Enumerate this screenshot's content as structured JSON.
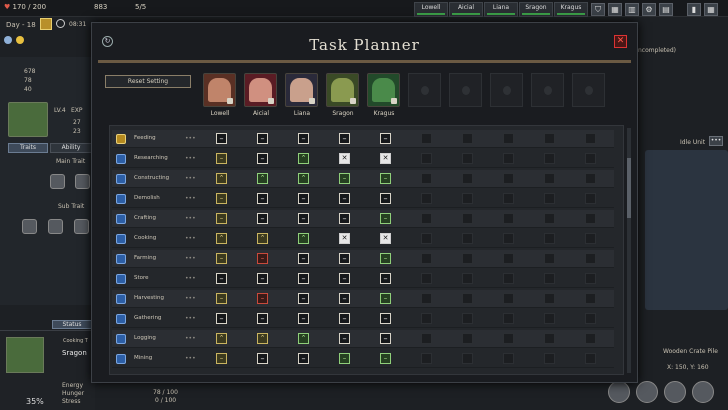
{
  "hud": {
    "day": "Day - 18",
    "time": "08:31",
    "food": "170 / 200",
    "coins": "883",
    "pop": "5/5",
    "stat1": "678",
    "stat2": "78",
    "stat3": "40",
    "colonist_tabs": [
      {
        "label": "Lowell"
      },
      {
        "label": "Aicial"
      },
      {
        "label": "Liana"
      },
      {
        "label": "Sragon"
      },
      {
        "label": "Kragus"
      }
    ]
  },
  "left_panel": {
    "level": "LV.4",
    "exp_label": "EXP",
    "v1": "27",
    "v2": "23",
    "tab_traits": "Traits",
    "tab_ability": "Ability",
    "main_trait": "Main Trait",
    "sub_trait": "Sub Trait"
  },
  "status_panel": {
    "tab_status": "Status",
    "name": "Sragon",
    "label_top": "Cooking T",
    "percent": "35%",
    "stat_energy": "Energy",
    "stat_hunger": "Hunger",
    "stat_stress": "Stress",
    "val_a": "78 / 100",
    "val_b": "0 / 100"
  },
  "right_side": {
    "completed": "ncompleted)",
    "idle_unit": "Idle Unit",
    "crate": "Wooden Crate Pile",
    "coords": "X: 150, Y: 160"
  },
  "modal": {
    "title": "Task Planner",
    "reset_label": "Reset Setting",
    "colonists": [
      "Lowell",
      "Aicial",
      "Liana",
      "Sragon",
      "Kragus"
    ],
    "tasks": [
      {
        "name": "Feeding",
        "icon": "yellow",
        "cells": [
          "white",
          "white",
          "white",
          "white",
          "white"
        ]
      },
      {
        "name": "Researching",
        "icon": "blue",
        "cells": [
          "yellow",
          "grey",
          "green_up",
          "x",
          "x"
        ]
      },
      {
        "name": "Constructing",
        "icon": "blue",
        "cells": [
          "yellow_up",
          "green_up",
          "green_up",
          "green",
          "green"
        ]
      },
      {
        "name": "Demolish",
        "icon": "blue",
        "cells": [
          "yellow",
          "grey",
          "grey",
          "grey",
          "grey"
        ]
      },
      {
        "name": "Crafting",
        "icon": "blue",
        "cells": [
          "yellow",
          "grey",
          "grey",
          "grey",
          "green"
        ]
      },
      {
        "name": "Cooking",
        "icon": "blue",
        "cells": [
          "yellow_up",
          "yellow_up",
          "green_up",
          "x",
          "x"
        ]
      },
      {
        "name": "Farming",
        "icon": "blue",
        "cells": [
          "yellow",
          "red",
          "grey",
          "grey",
          "green"
        ]
      },
      {
        "name": "Store",
        "icon": "blue",
        "cells": [
          "white",
          "white",
          "white",
          "white",
          "white"
        ]
      },
      {
        "name": "Harvesting",
        "icon": "blue",
        "cells": [
          "yellow",
          "red",
          "grey",
          "grey",
          "green"
        ]
      },
      {
        "name": "Gathering",
        "icon": "blue",
        "cells": [
          "white",
          "grey",
          "grey",
          "grey",
          "grey"
        ]
      },
      {
        "name": "Logging",
        "icon": "blue",
        "cells": [
          "yellow_up",
          "yellow_up",
          "green_up",
          "grey",
          "grey"
        ]
      },
      {
        "name": "Mining",
        "icon": "blue",
        "cells": [
          "yellow",
          "grey",
          "grey",
          "green",
          "green"
        ]
      }
    ]
  }
}
